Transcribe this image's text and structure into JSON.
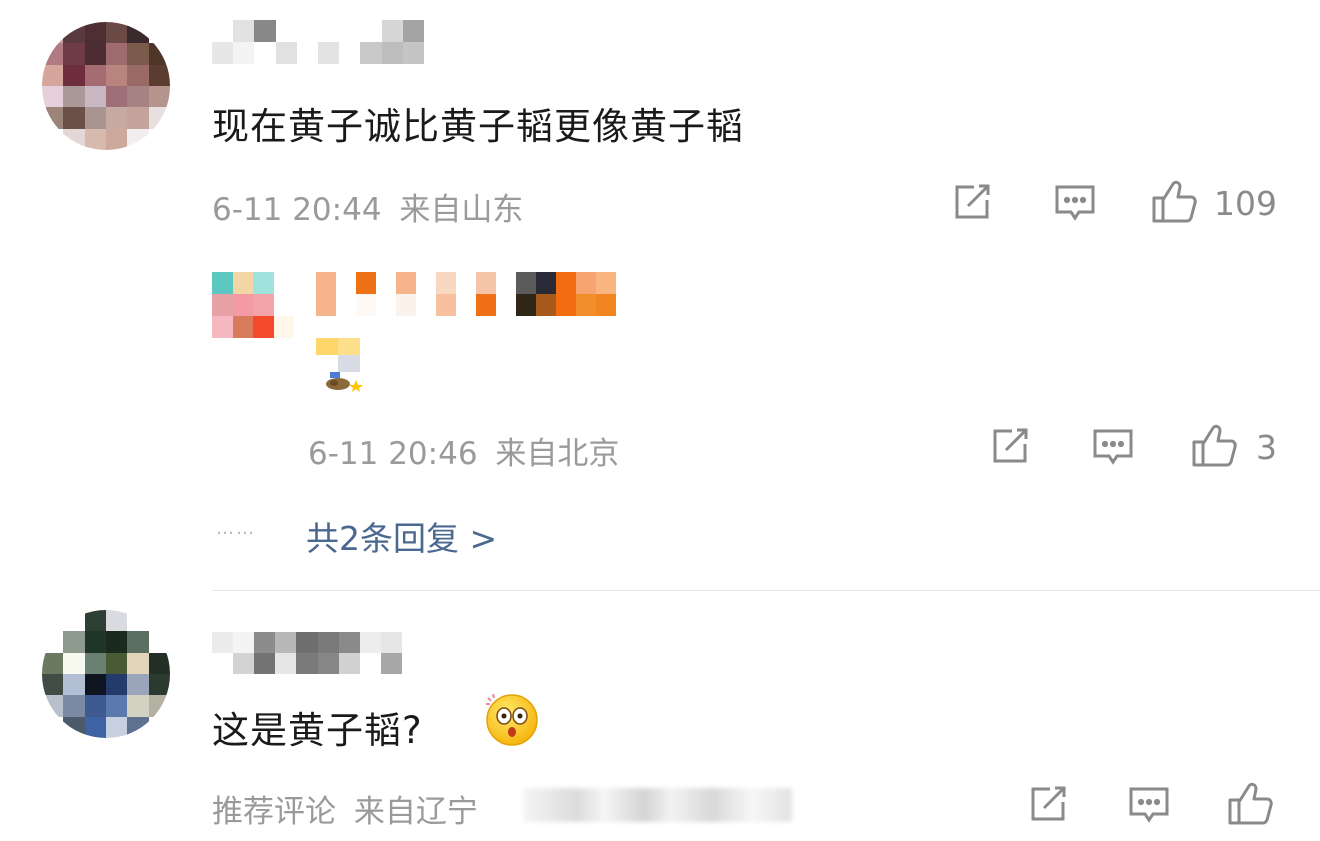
{
  "comment1": {
    "text": "现在黄子诚比黄子韬更像黄子韬",
    "date": "6-11 20:44",
    "location": "来自山东",
    "like_count": "109",
    "reply": {
      "date": "6-11 20:46",
      "location": "来自北京",
      "like_count": "3"
    },
    "more_replies": "共2条回复 >",
    "dots": "……"
  },
  "comment2": {
    "text": "这是黄子韬?",
    "label": "推荐评论",
    "location": "来自辽宁"
  },
  "icons": {
    "share": "share-icon",
    "comment": "comment-icon",
    "like": "thumbs-up-icon",
    "emoji": "shocked-face-emoji-icon",
    "badge": "user-badge-icon"
  },
  "colors": {
    "meta_text": "#9a9a9a",
    "link_blue": "#4a6890",
    "icon_gray": "#8a8a8a"
  }
}
